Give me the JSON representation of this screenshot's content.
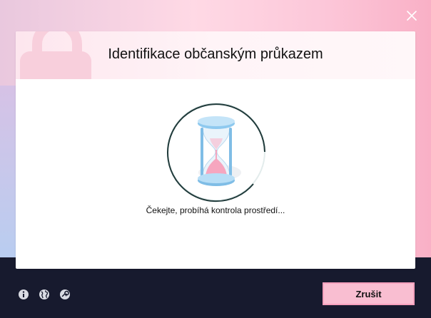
{
  "dialog": {
    "title": "Identifikace občanským průkazem",
    "status_text": "Čekejte, probíhá kontrola prostředí...",
    "cancel_label": "Zrušit"
  },
  "icons": {
    "close": "close-icon",
    "illustration": "hourglass-icon",
    "footer": [
      "info-icon",
      "globe-icon",
      "support-icon"
    ]
  },
  "colors": {
    "accent_pink": "#f9bed1",
    "accent_border": "#f7a1bd",
    "footer_bg": "#171a2e",
    "spinner_ring": "#1f3a3a"
  }
}
